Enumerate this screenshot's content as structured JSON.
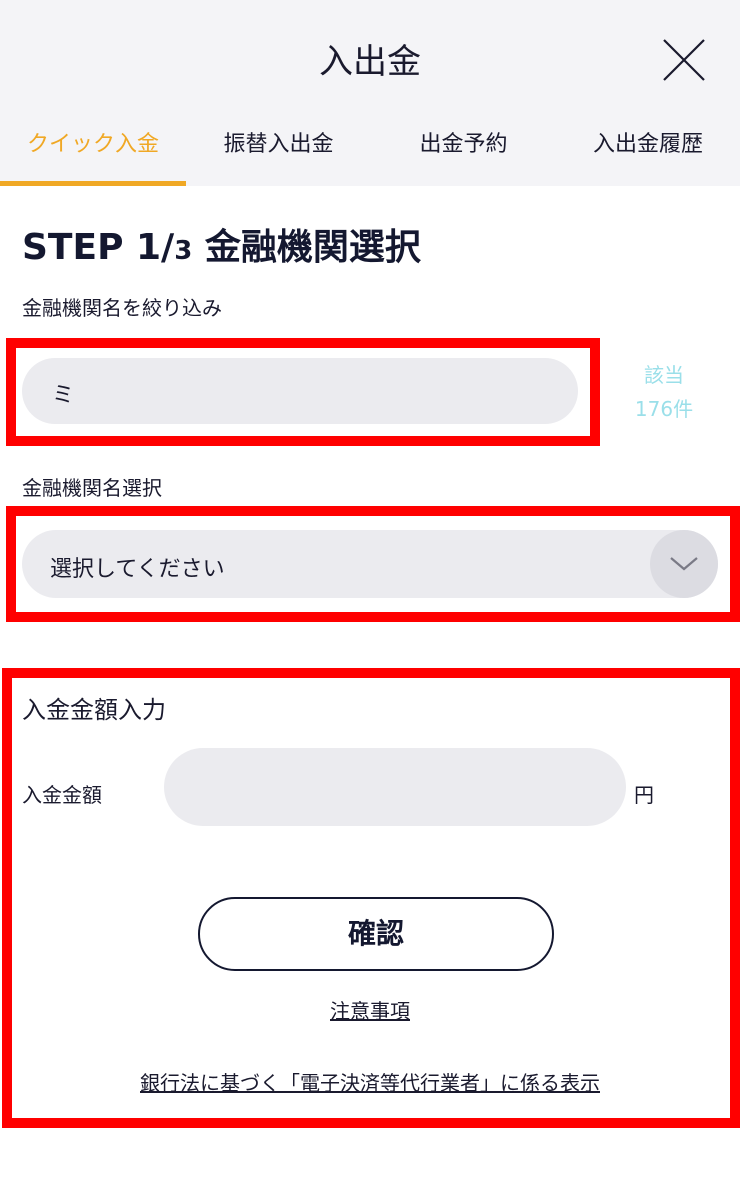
{
  "header": {
    "title": "入出金",
    "close_icon": "close-icon"
  },
  "tabs": [
    {
      "label": "クイック入金",
      "active": true
    },
    {
      "label": "振替入出金",
      "active": false
    },
    {
      "label": "出金予約",
      "active": false
    },
    {
      "label": "入出金履歴",
      "active": false
    }
  ],
  "step": {
    "prefix": "STEP 1/",
    "num": "3",
    "title": "金融機関選択"
  },
  "filter": {
    "label": "金融機関名を絞り込み",
    "value": "ミ",
    "count_line1": "該当",
    "count_line2": "176件"
  },
  "bank_select": {
    "label": "金融機関名選択",
    "selected": "選択してください",
    "icon": "chevron-down-icon"
  },
  "amount": {
    "section_title": "入金金額入力",
    "label": "入金金額",
    "value": "",
    "unit": "円"
  },
  "actions": {
    "confirm_label": "確認",
    "notes_link": "注意事項",
    "disclosure_link": "銀行法に基づく「電子決済等代行業者」に係る表示"
  },
  "colors": {
    "accent": "#f0a825",
    "highlight": "#ff0000",
    "count_text": "#9adfe9",
    "field_bg": "#ebebef",
    "header_bg": "#f4f4f7"
  }
}
